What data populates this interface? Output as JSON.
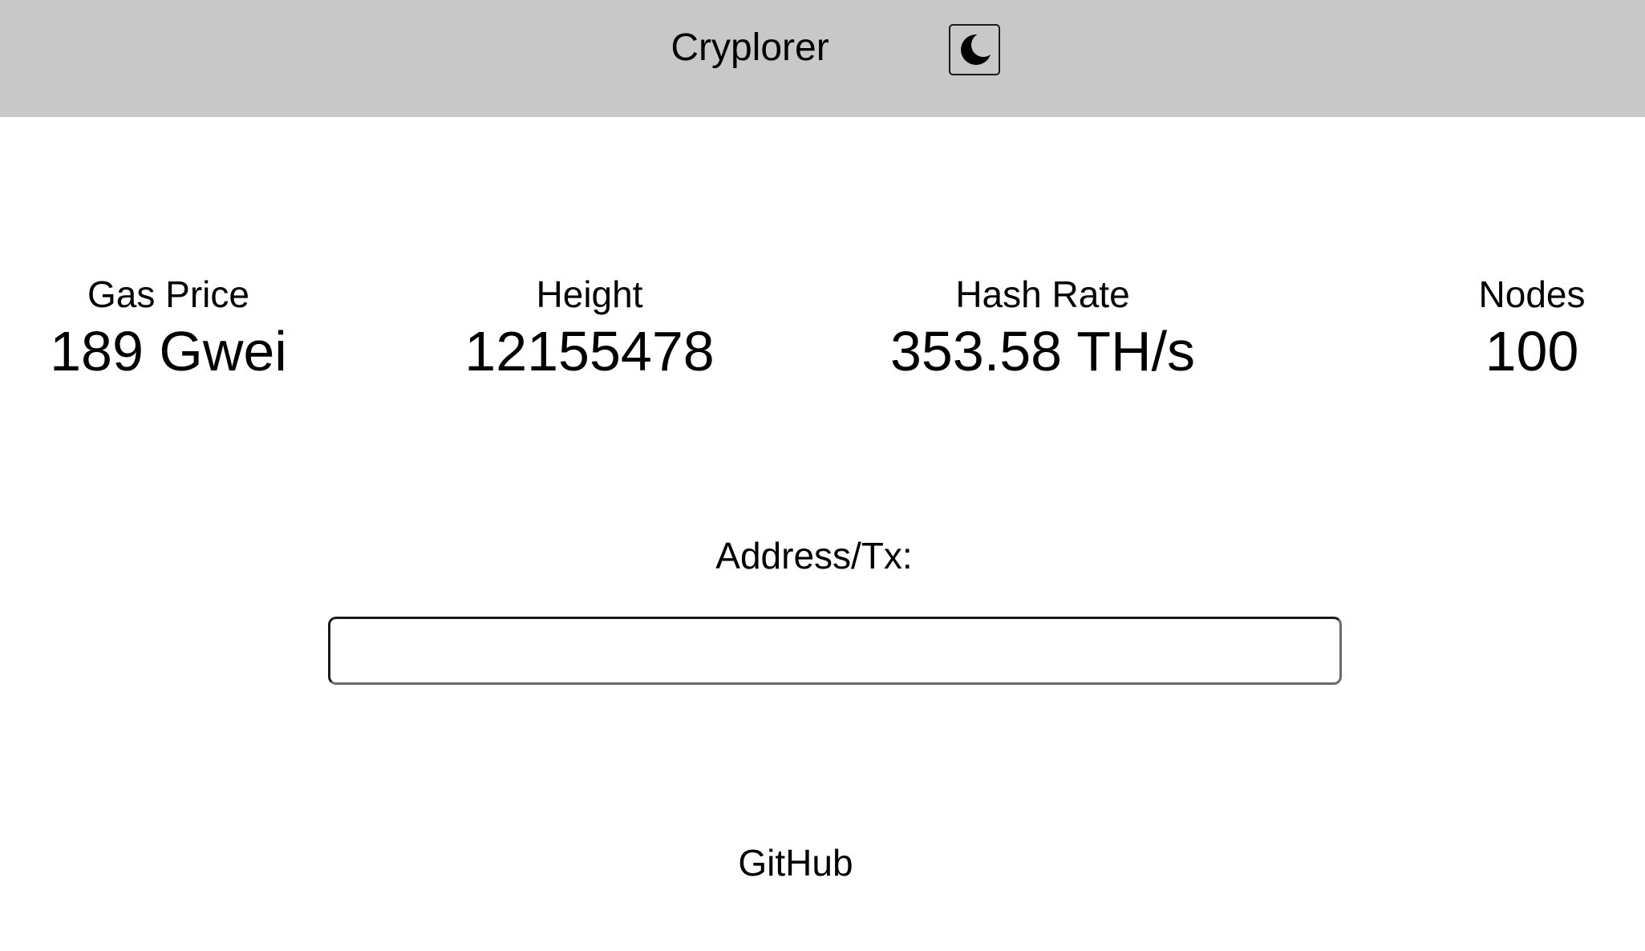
{
  "header": {
    "title": "Cryplorer",
    "theme_toggle_icon": "moon-icon",
    "background": "#c8c8c8"
  },
  "stats": {
    "gas_price": {
      "label": "Gas Price",
      "value": "189 Gwei"
    },
    "height": {
      "label": "Height",
      "value": "12155478"
    },
    "hash_rate": {
      "label": "Hash Rate",
      "value": "353.58 TH/s"
    },
    "nodes": {
      "label": "Nodes",
      "value": "100"
    }
  },
  "search": {
    "label": "Address/Tx:",
    "value": "",
    "placeholder": ""
  },
  "footer": {
    "github_label": "GitHub"
  }
}
